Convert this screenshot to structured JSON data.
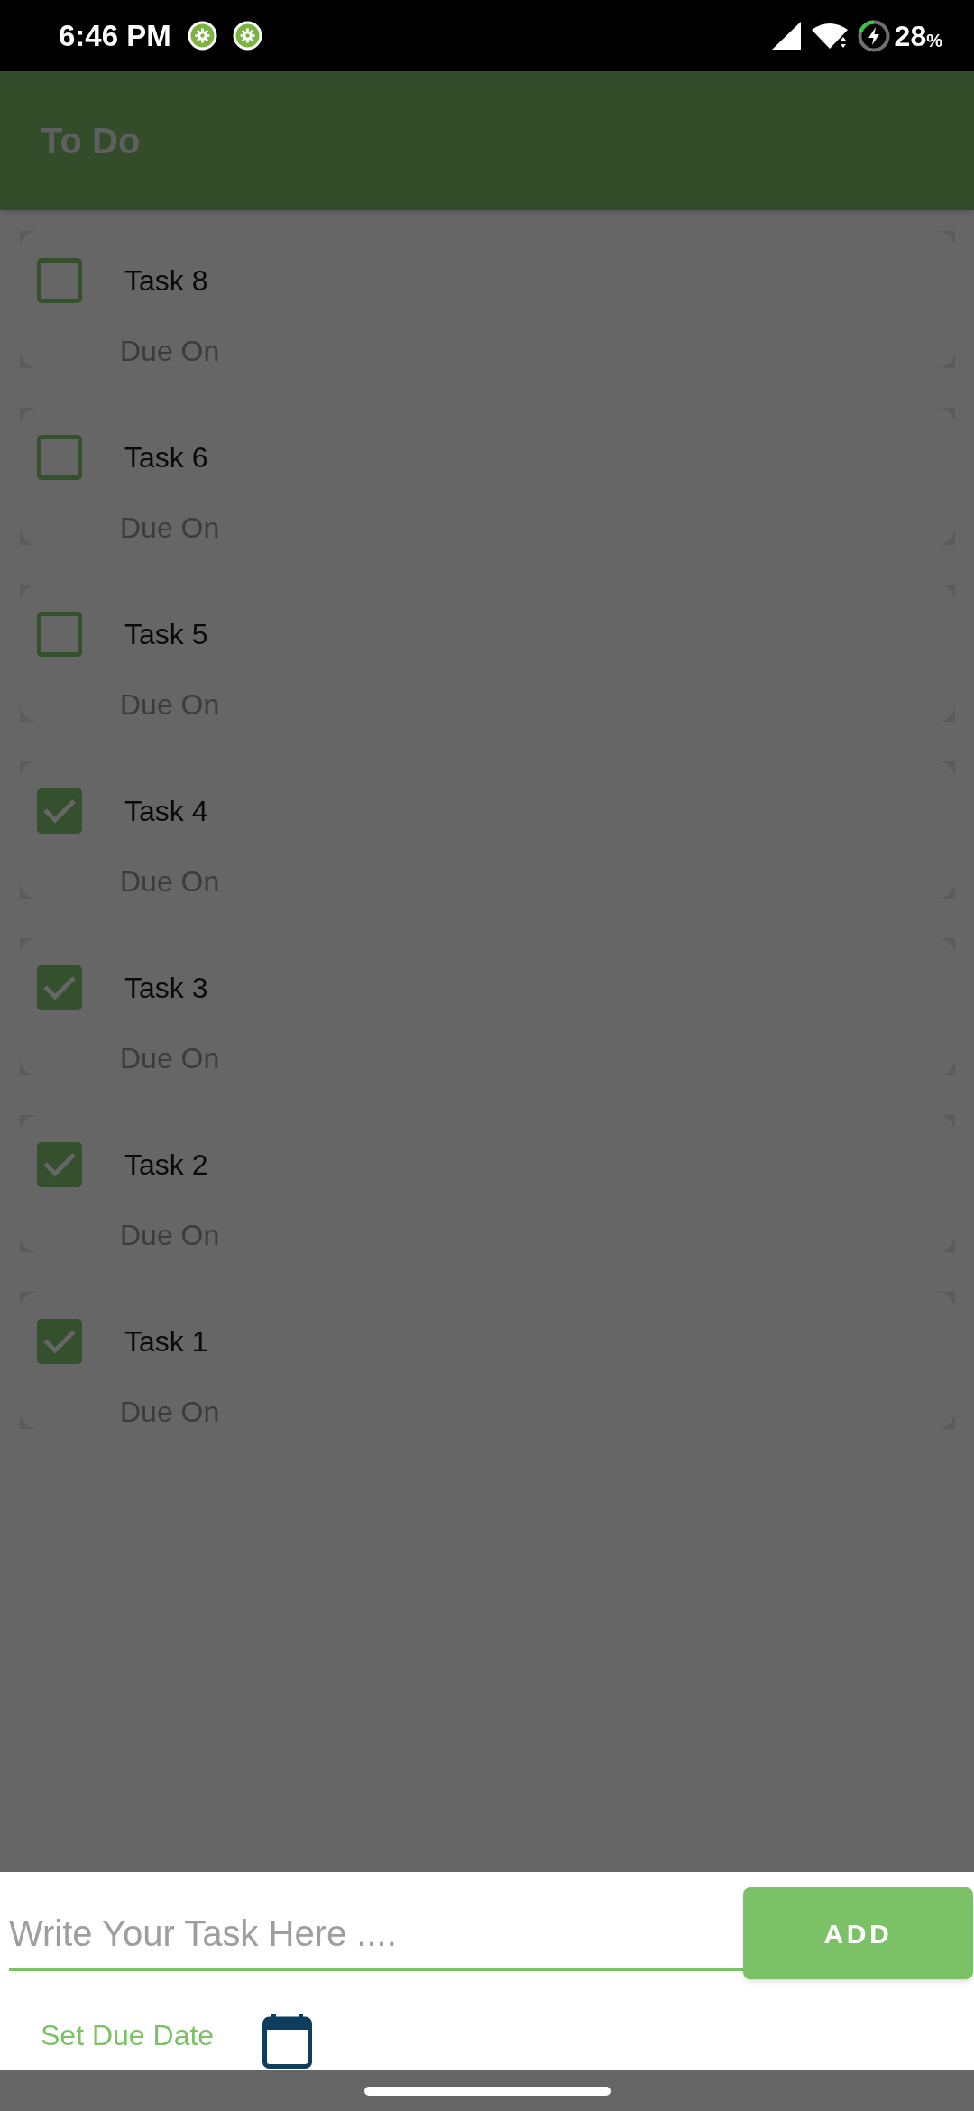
{
  "status_bar": {
    "time": "6:46 PM",
    "battery": "28",
    "battery_unit": "%"
  },
  "app_bar": {
    "title": "To Do"
  },
  "tasks": [
    {
      "title": "Task 8",
      "due_label": "Due On",
      "checked": false
    },
    {
      "title": "Task 6",
      "due_label": "Due On",
      "checked": false
    },
    {
      "title": "Task 5",
      "due_label": "Due On",
      "checked": false
    },
    {
      "title": "Task 4",
      "due_label": "Due On",
      "checked": true
    },
    {
      "title": "Task 3",
      "due_label": "Due On",
      "checked": true
    },
    {
      "title": "Task 2",
      "due_label": "Due On",
      "checked": true
    },
    {
      "title": "Task 1",
      "due_label": "Due On",
      "checked": true
    }
  ],
  "new_task": {
    "placeholder": "Write Your Task Here ....",
    "add_button": "ADD",
    "due_date_button": "Set Due Date"
  }
}
